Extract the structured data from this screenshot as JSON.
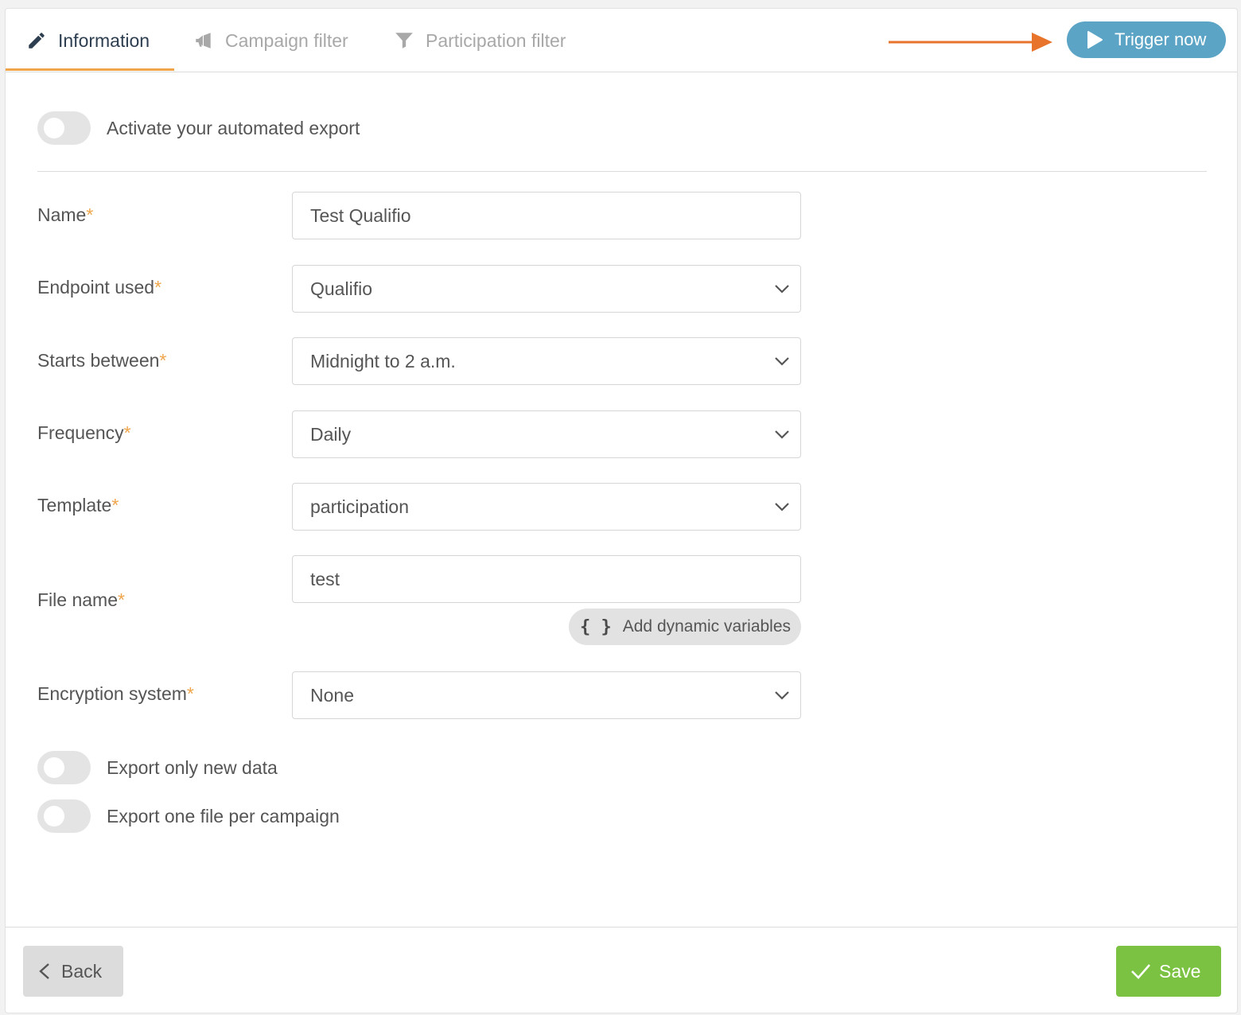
{
  "tabs": {
    "information": "Information",
    "campaign_filter": "Campaign filter",
    "participation_filter": "Participation filter"
  },
  "trigger_button": "Trigger now",
  "activate_toggle": {
    "label": "Activate your automated export",
    "on": false
  },
  "form": {
    "name": {
      "label": "Name",
      "required": "*",
      "value": "Test Qualifio"
    },
    "endpoint": {
      "label": "Endpoint used",
      "required": "*",
      "value": "Qualifio"
    },
    "starts_between": {
      "label": "Starts between",
      "required": "*",
      "value": "Midnight to 2 a.m."
    },
    "frequency": {
      "label": "Frequency",
      "required": "*",
      "value": "Daily"
    },
    "template": {
      "label": "Template",
      "required": "*",
      "value": "participation"
    },
    "file_name": {
      "label": "File name",
      "required": "*",
      "value": "test"
    },
    "dynamic_variables_button": "Add dynamic variables",
    "dynamic_variables_icon": "{ }",
    "encryption": {
      "label": "Encryption system",
      "required": "*",
      "value": "None"
    }
  },
  "export_only_new_toggle": {
    "label": "Export only new data",
    "on": false
  },
  "export_one_file_toggle": {
    "label": "Export one file per campaign",
    "on": false
  },
  "footer": {
    "back": "Back",
    "save": "Save"
  },
  "colors": {
    "accent_orange": "#f0a54a",
    "arrow_orange": "#e8742c",
    "trigger_blue": "#5ba4c6",
    "save_green": "#7cc242"
  },
  "icons": {
    "information": "pencil-icon",
    "campaign_filter": "megaphone-icon",
    "participation_filter": "funnel-icon",
    "trigger": "play-icon",
    "back": "chevron-left-icon",
    "save": "check-icon"
  }
}
